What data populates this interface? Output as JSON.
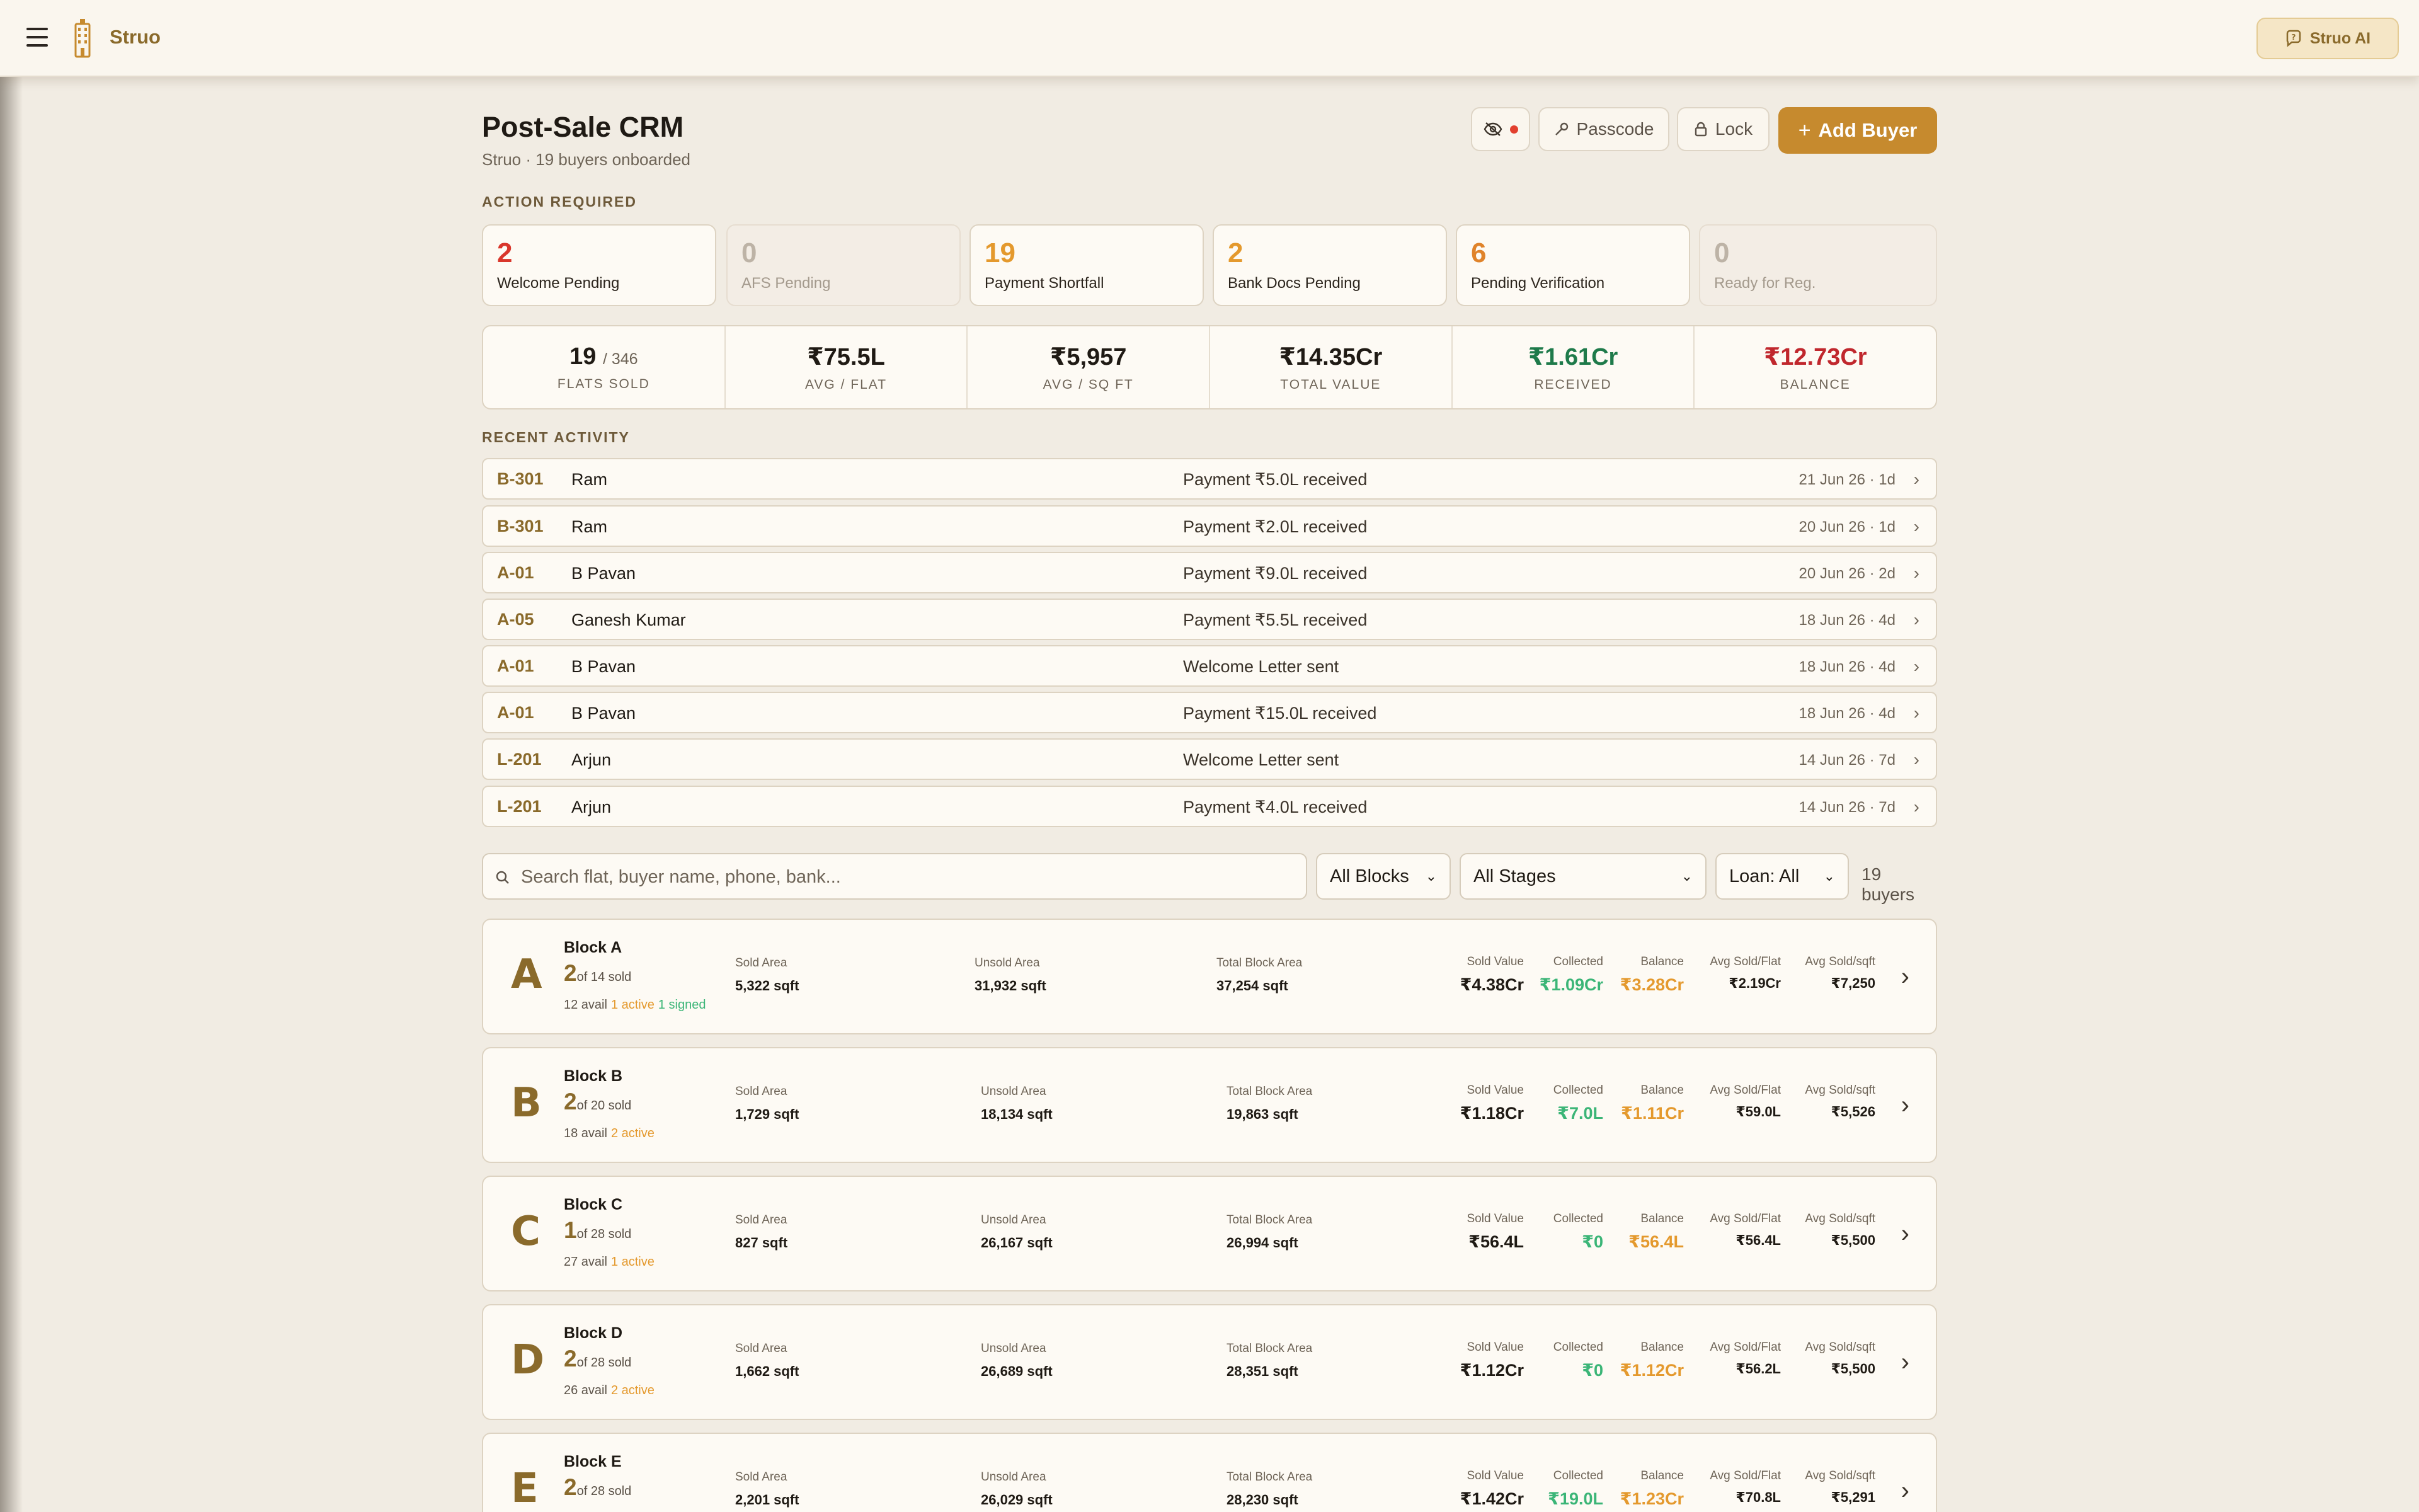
{
  "app": {
    "brand": "Struo",
    "ai_label": "Struo AI"
  },
  "header": {
    "title": "Post-Sale CRM",
    "subtitle": "Struo · 19 buyers onboarded",
    "passcode_label": "Passcode",
    "lock_label": "Lock",
    "add_label": "Add Buyer"
  },
  "action_required": {
    "label": "ACTION REQUIRED",
    "cards": [
      {
        "value": "2",
        "label": "Welcome Pending",
        "color": "#D9362B"
      },
      {
        "value": "0",
        "label": "AFS Pending",
        "color": "#BDB3A6"
      },
      {
        "value": "19",
        "label": "Payment Shortfall",
        "color": "#E4992D"
      },
      {
        "value": "2",
        "label": "Bank Docs Pending",
        "color": "#E4992D"
      },
      {
        "value": "6",
        "label": "Pending Verification",
        "color": "#E0832A"
      },
      {
        "value": "0",
        "label": "Ready for Reg.",
        "color": "#BDB3A6"
      }
    ]
  },
  "stats": {
    "flats_sold": "19",
    "flats_total": "/ 346",
    "flats_sold_label": "FLATS SOLD",
    "avg_flat": "₹75.5L",
    "avg_flat_label": "AVG / FLAT",
    "avg_sqft": "₹5,957",
    "avg_sqft_label": "AVG / SQ FT",
    "total_value": "₹14.35Cr",
    "total_value_label": "TOTAL VALUE",
    "received": "₹1.61Cr",
    "received_label": "RECEIVED",
    "balance": "₹12.73Cr",
    "balance_label": "BALANCE",
    "received_color": "#1E7A4A",
    "balance_color": "#C0272D"
  },
  "activity": {
    "label": "RECENT ACTIVITY",
    "rows": [
      {
        "flat": "B-301",
        "name": "Ram",
        "event": "Payment ₹5.0L received",
        "date": "21 Jun 26 · 1d"
      },
      {
        "flat": "B-301",
        "name": "Ram",
        "event": "Payment ₹2.0L received",
        "date": "20 Jun 26 · 1d"
      },
      {
        "flat": "A-01",
        "name": "B Pavan",
        "event": "Payment ₹9.0L received",
        "date": "20 Jun 26 · 2d"
      },
      {
        "flat": "A-05",
        "name": "Ganesh Kumar",
        "event": "Payment ₹5.5L received",
        "date": "18 Jun 26 · 4d"
      },
      {
        "flat": "A-01",
        "name": "B Pavan",
        "event": "Welcome Letter sent",
        "date": "18 Jun 26 · 4d"
      },
      {
        "flat": "A-01",
        "name": "B Pavan",
        "event": "Payment ₹15.0L received",
        "date": "18 Jun 26 · 4d"
      },
      {
        "flat": "L-201",
        "name": "Arjun",
        "event": "Welcome Letter sent",
        "date": "14 Jun 26 · 7d"
      },
      {
        "flat": "L-201",
        "name": "Arjun",
        "event": "Payment ₹4.0L received",
        "date": "14 Jun 26 · 7d"
      }
    ]
  },
  "filters": {
    "search_placeholder": "Search flat, buyer name, phone, bank...",
    "blocks": "All Blocks",
    "stages": "All Stages",
    "loan": "Loan: All",
    "count": "19 buyers"
  },
  "block_labels": {
    "sold_area": "Sold Area",
    "unsold_area": "Unsold Area",
    "total_area": "Total Block Area",
    "sold_value": "Sold Value",
    "collected": "Collected",
    "balance": "Balance",
    "avg_flat": "Avg Sold/Flat",
    "avg_sqft": "Avg Sold/sqft"
  },
  "blocks": [
    {
      "letter": "A",
      "name": "Block A",
      "sold": "2",
      "of": "of 14 sold",
      "avail": "12 avail",
      "active": "1 active",
      "signed": "1 signed",
      "sold_area": "5,322 sqft",
      "unsold_area": "31,932 sqft",
      "total_area": "37,254 sqft",
      "sold_value": "₹4.38Cr",
      "collected": "₹1.09Cr",
      "balance": "₹3.28Cr",
      "avg_flat": "₹2.19Cr",
      "avg_sqft": "₹7,250"
    },
    {
      "letter": "B",
      "name": "Block B",
      "sold": "2",
      "of": "of 20 sold",
      "avail": "18 avail",
      "active": "2 active",
      "signed": "",
      "sold_area": "1,729 sqft",
      "unsold_area": "18,134 sqft",
      "total_area": "19,863 sqft",
      "sold_value": "₹1.18Cr",
      "collected": "₹7.0L",
      "balance": "₹1.11Cr",
      "avg_flat": "₹59.0L",
      "avg_sqft": "₹5,526"
    },
    {
      "letter": "C",
      "name": "Block C",
      "sold": "1",
      "of": "of 28 sold",
      "avail": "27 avail",
      "active": "1 active",
      "signed": "",
      "sold_area": "827 sqft",
      "unsold_area": "26,167 sqft",
      "total_area": "26,994 sqft",
      "sold_value": "₹56.4L",
      "collected": "₹0",
      "balance": "₹56.4L",
      "avg_flat": "₹56.4L",
      "avg_sqft": "₹5,500"
    },
    {
      "letter": "D",
      "name": "Block D",
      "sold": "2",
      "of": "of 28 sold",
      "avail": "26 avail",
      "active": "2 active",
      "signed": "",
      "sold_area": "1,662 sqft",
      "unsold_area": "26,689 sqft",
      "total_area": "28,351 sqft",
      "sold_value": "₹1.12Cr",
      "collected": "₹0",
      "balance": "₹1.12Cr",
      "avg_flat": "₹56.2L",
      "avg_sqft": "₹5,500"
    },
    {
      "letter": "E",
      "name": "Block E",
      "sold": "2",
      "of": "of 28 sold",
      "avail": "",
      "active": "",
      "signed": "",
      "sold_area": "2,201 sqft",
      "unsold_area": "26,029 sqft",
      "total_area": "28,230 sqft",
      "sold_value": "₹1.42Cr",
      "collected": "₹19.0L",
      "balance": "₹1.23Cr",
      "avg_flat": "₹70.8L",
      "avg_sqft": "₹5,291"
    }
  ]
}
